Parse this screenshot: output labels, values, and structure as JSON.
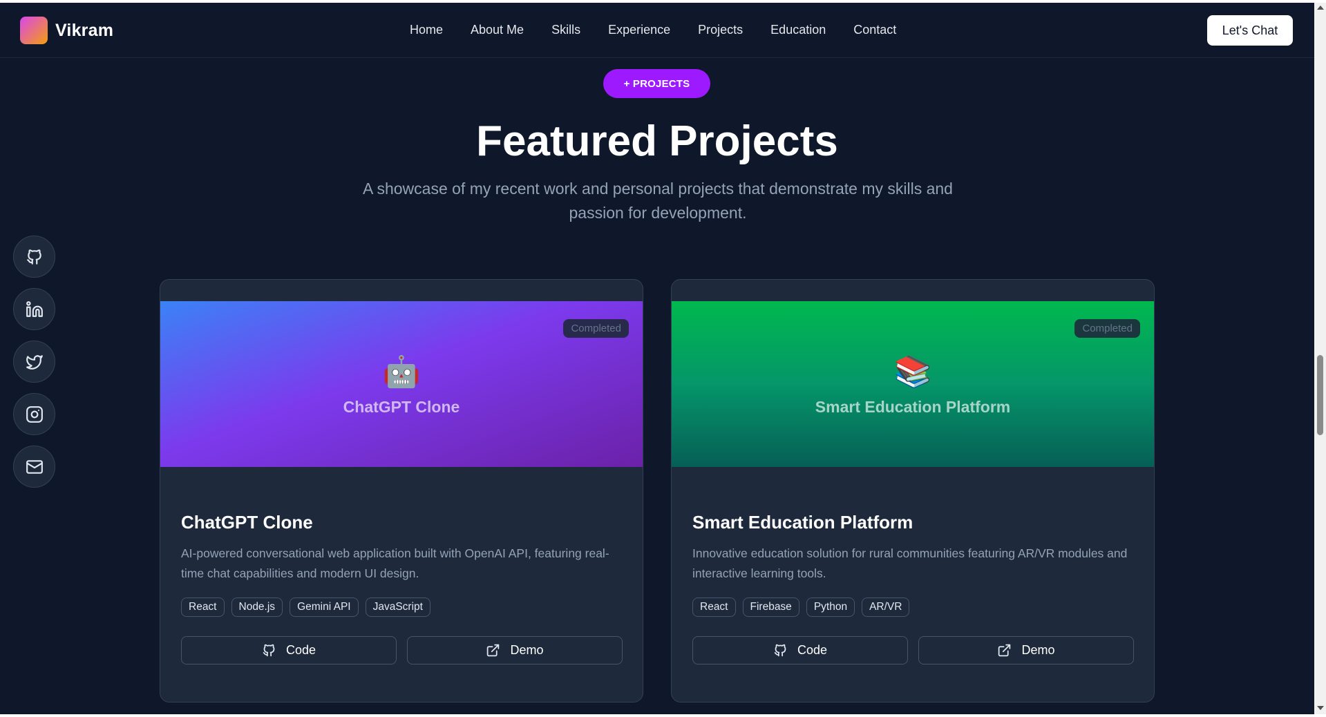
{
  "header": {
    "brand": "Vikram",
    "nav": [
      "Home",
      "About Me",
      "Skills",
      "Experience",
      "Projects",
      "Education",
      "Contact"
    ],
    "cta": "Let's Chat"
  },
  "hero": {
    "pill": "+ PROJECTS",
    "title": "Featured Projects",
    "subtitle": "A showcase of my recent work and personal projects that demonstrate my skills and passion for development."
  },
  "social": [
    "github-icon",
    "linkedin-icon",
    "twitter-icon",
    "instagram-icon",
    "mail-icon"
  ],
  "projects": [
    {
      "status": "Completed",
      "emoji": "🤖",
      "banner_title": "ChatGPT Clone",
      "title": "ChatGPT Clone",
      "description": "AI-powered conversational web application built with OpenAI API, featuring real-time chat capabilities and modern UI design.",
      "tags": [
        "React",
        "Node.js",
        "Gemini API",
        "JavaScript"
      ],
      "code_label": "Code",
      "demo_label": "Demo"
    },
    {
      "status": "Completed",
      "emoji": "📚",
      "banner_title": "Smart Education Platform",
      "title": "Smart Education Platform",
      "description": "Innovative education solution for rural communities featuring AR/VR modules and interactive learning tools.",
      "tags": [
        "React",
        "Firebase",
        "Python",
        "AR/VR"
      ],
      "code_label": "Code",
      "demo_label": "Demo"
    }
  ],
  "colors": {
    "background": "#0f172a",
    "card": "#1e293b",
    "accent": "#9d1aff"
  }
}
